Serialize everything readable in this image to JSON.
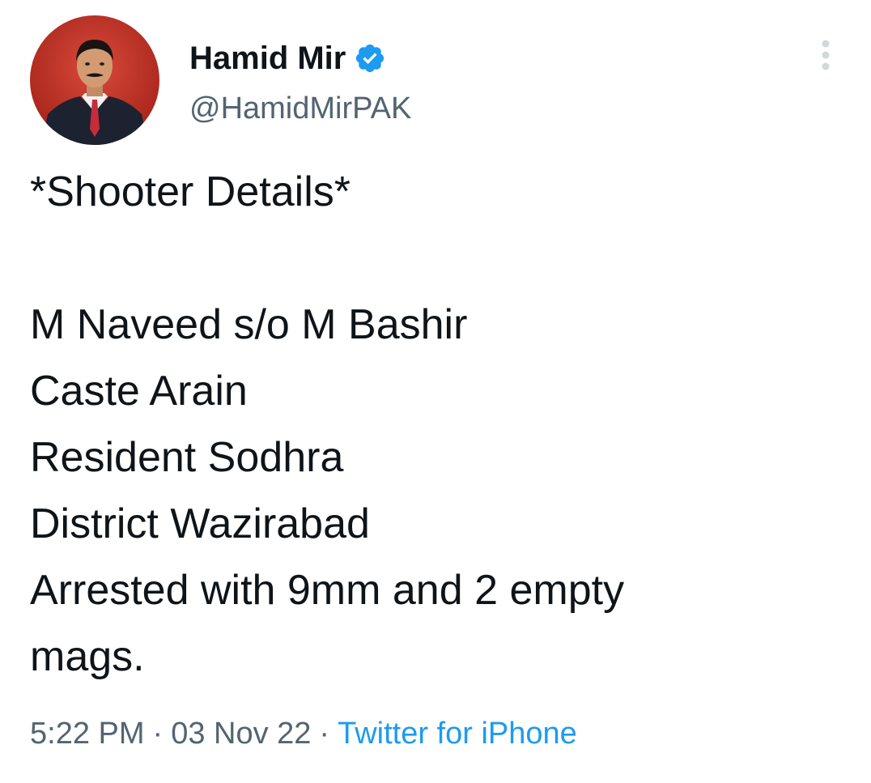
{
  "author": {
    "display_name": "Hamid Mir",
    "handle": "@HamidMirPAK",
    "verified": true,
    "avatar_icon": "profile-avatar",
    "verified_icon": "verified-badge-icon",
    "verified_color": "#1d9bf0"
  },
  "menu": {
    "icon": "more-options-icon"
  },
  "tweet": {
    "lines": [
      "*Shooter Details*",
      "",
      "M Naveed s/o M Bashir",
      "Caste Arain",
      "Resident Sodhra",
      "District Wazirabad",
      "Arrested with 9mm and 2 empty",
      "mags."
    ]
  },
  "meta": {
    "time": "5:22 PM",
    "separator": "·",
    "date": "03 Nov 22",
    "source": "Twitter for iPhone"
  },
  "colors": {
    "text": "#0f1419",
    "secondary": "#536471",
    "link": "#1d9bf0"
  }
}
